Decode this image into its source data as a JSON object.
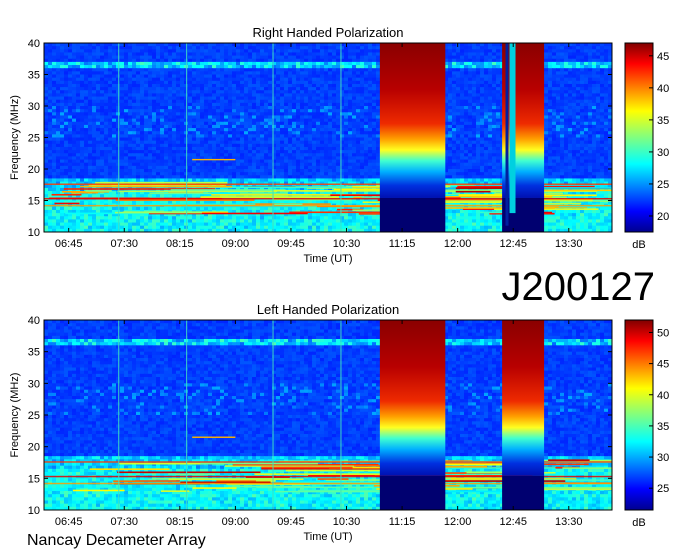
{
  "page": {
    "identifier": "J200127",
    "footer": "Nancay Decameter Array"
  },
  "chart_data": [
    {
      "type": "heatmap",
      "title": "Right Handed Polarization",
      "xlabel": "Time (UT)",
      "ylabel": "Frequency (MHz)",
      "x_ticks": [
        "06:45",
        "07:30",
        "08:15",
        "09:00",
        "09:45",
        "10:30",
        "11:15",
        "12:00",
        "12:45",
        "13:30"
      ],
      "y_ticks": [
        10,
        15,
        20,
        25,
        30,
        35,
        40
      ],
      "ylim": [
        10,
        40
      ],
      "colorbar": {
        "label": "dB",
        "ticks": [
          20,
          25,
          30,
          35,
          40,
          45
        ],
        "range": [
          17.5,
          47
        ],
        "colormap": "jet"
      },
      "features": [
        {
          "kind": "saturated_block",
          "time_start": "10:57",
          "time_end": "11:50",
          "level_db": 45
        },
        {
          "kind": "saturated_block",
          "time_start": "12:36",
          "time_end": "13:10",
          "level_db": 45
        },
        {
          "kind": "dropout",
          "time": "12:42",
          "level_db": 22
        },
        {
          "kind": "emission_band",
          "freq_low": 13,
          "freq_high": 18,
          "level_db": 35
        },
        {
          "kind": "interference_line",
          "freq": 36.3,
          "level_db": 28
        }
      ]
    },
    {
      "type": "heatmap",
      "title": "Left Handed Polarization",
      "xlabel": "Time (UT)",
      "ylabel": "Frequency (MHz)",
      "x_ticks": [
        "06:45",
        "07:30",
        "08:15",
        "09:00",
        "09:45",
        "10:30",
        "11:15",
        "12:00",
        "12:45",
        "13:30"
      ],
      "y_ticks": [
        10,
        15,
        20,
        25,
        30,
        35,
        40
      ],
      "ylim": [
        10,
        40
      ],
      "colorbar": {
        "label": "dB",
        "ticks": [
          25,
          30,
          35,
          40,
          45,
          50
        ],
        "range": [
          21.5,
          52
        ],
        "colormap": "jet"
      },
      "features": [
        {
          "kind": "saturated_block",
          "time_start": "10:57",
          "time_end": "11:50",
          "level_db": 50
        },
        {
          "kind": "saturated_block",
          "time_start": "12:36",
          "time_end": "13:10",
          "level_db": 50
        },
        {
          "kind": "emission_band",
          "freq_low": 13,
          "freq_high": 18,
          "level_db": 38
        },
        {
          "kind": "interference_line",
          "freq": 36.3,
          "level_db": 30
        }
      ]
    }
  ]
}
